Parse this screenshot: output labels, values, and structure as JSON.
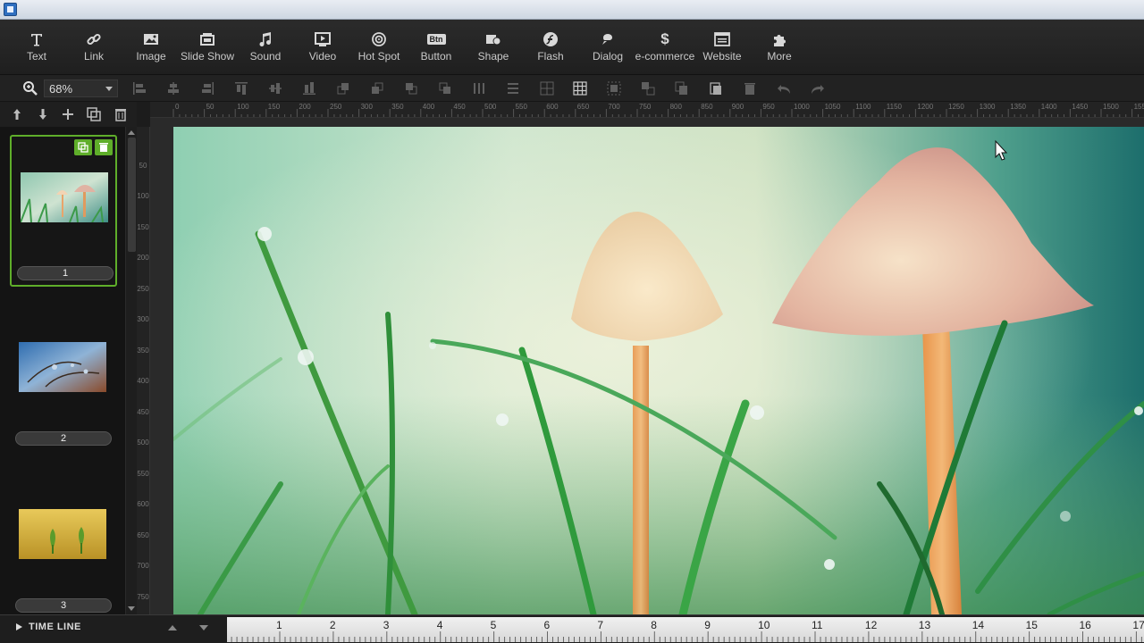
{
  "toolbar": {
    "items": [
      {
        "label": "Text",
        "icon": "text-icon"
      },
      {
        "label": "Link",
        "icon": "link-icon"
      },
      {
        "label": "Image",
        "icon": "image-icon"
      },
      {
        "label": "Slide Show",
        "icon": "slideshow-icon"
      },
      {
        "label": "Sound",
        "icon": "music-note-icon"
      },
      {
        "label": "Video",
        "icon": "video-icon"
      },
      {
        "label": "Hot Spot",
        "icon": "target-icon"
      },
      {
        "label": "Button",
        "icon": "button-icon"
      },
      {
        "label": "Shape",
        "icon": "shape-icon"
      },
      {
        "label": "Flash",
        "icon": "flash-icon"
      },
      {
        "label": "Dialog",
        "icon": "dialog-icon"
      },
      {
        "label": "e-commerce",
        "icon": "dollar-icon"
      },
      {
        "label": "Website",
        "icon": "website-icon"
      },
      {
        "label": "More",
        "icon": "puzzle-icon"
      }
    ],
    "button_icon_text": "Btn"
  },
  "zoom": {
    "value": "68%"
  },
  "slides": {
    "items": [
      {
        "number": "1",
        "selected": true
      },
      {
        "number": "2",
        "selected": false
      },
      {
        "number": "3",
        "selected": false
      }
    ]
  },
  "ruler": {
    "top": [
      "0",
      "50",
      "100",
      "150",
      "200",
      "250",
      "300",
      "350",
      "400",
      "450",
      "500",
      "550",
      "600",
      "650",
      "700",
      "750",
      "800",
      "850",
      "900",
      "950",
      "1000",
      "1050",
      "1100",
      "1150",
      "1200",
      "1250",
      "1300",
      "1350",
      "1400",
      "1450",
      "1500",
      "1550"
    ],
    "left": [
      "0",
      "50",
      "100",
      "150",
      "200",
      "250",
      "300",
      "350",
      "400",
      "450",
      "500",
      "550",
      "600",
      "650",
      "700",
      "750"
    ]
  },
  "timeline": {
    "label": "TIME LINE",
    "marks": [
      "1",
      "2",
      "3",
      "4",
      "5",
      "6",
      "7",
      "8",
      "9",
      "10",
      "11",
      "12",
      "13",
      "14",
      "15",
      "16",
      "17"
    ]
  },
  "colors": {
    "accent": "#5fae2a",
    "toolbar_bg": "#242424"
  }
}
